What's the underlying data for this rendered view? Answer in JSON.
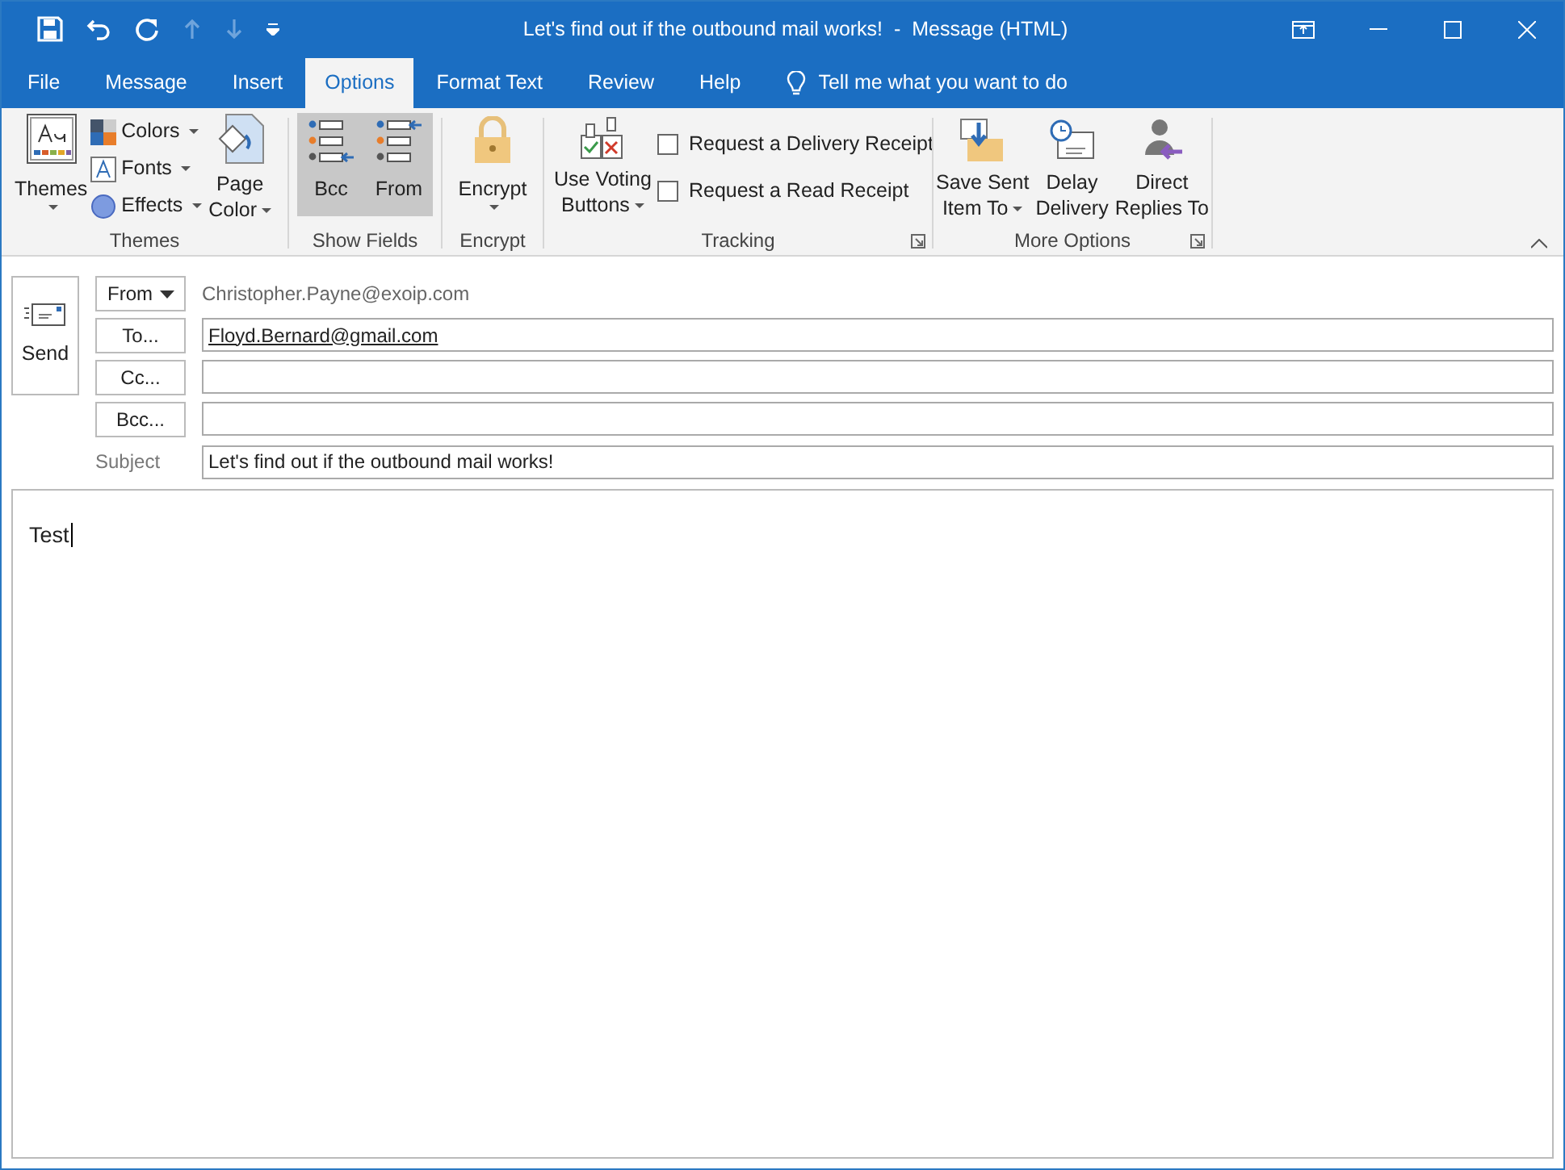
{
  "window": {
    "title": "Let's find out if the outbound mail works!  -  Message (HTML)"
  },
  "tabs": [
    {
      "label": "File",
      "selected": false
    },
    {
      "label": "Message",
      "selected": false
    },
    {
      "label": "Insert",
      "selected": false
    },
    {
      "label": "Options",
      "selected": true
    },
    {
      "label": "Format Text",
      "selected": false
    },
    {
      "label": "Review",
      "selected": false
    },
    {
      "label": "Help",
      "selected": false
    }
  ],
  "tell_me": {
    "placeholder": "Tell me what you want to do"
  },
  "ribbon": {
    "themes": {
      "label": "Themes",
      "themes_button": "Themes",
      "colors": "Colors",
      "fonts": "Fonts",
      "effects": "Effects",
      "page_color": [
        "Page",
        "Color"
      ]
    },
    "show_fields": {
      "label": "Show Fields",
      "buttons": [
        {
          "label": "Bcc",
          "selected": true
        },
        {
          "label": "From",
          "selected": true
        }
      ]
    },
    "encrypt": {
      "label": "Encrypt",
      "button": "Encrypt"
    },
    "tracking": {
      "label": "Tracking",
      "voting": [
        "Use Voting",
        "Buttons"
      ],
      "checkboxes": [
        {
          "label": "Request a Delivery Receipt",
          "checked": false
        },
        {
          "label": "Request a Read Receipt",
          "checked": false
        }
      ]
    },
    "more_options": {
      "label": "More Options",
      "buttons": [
        {
          "kind": "save",
          "lines": [
            "Save Sent",
            "Item To"
          ]
        },
        {
          "kind": "delay",
          "lines": [
            "Delay",
            "Delivery"
          ]
        },
        {
          "kind": "replies",
          "lines": [
            "Direct",
            "Replies To"
          ]
        }
      ]
    }
  },
  "compose": {
    "send": "Send",
    "from_button": "From",
    "from_value": "Christopher.Payne@exoip.com",
    "recipients": [
      {
        "button": "To...",
        "value": "Floyd.Bernard@gmail.com"
      },
      {
        "button": "Cc..."
      },
      {
        "button": "Bcc..."
      }
    ],
    "subject_label": "Subject",
    "subject": "Let's find out if the outbound mail works!",
    "body": "Test"
  }
}
